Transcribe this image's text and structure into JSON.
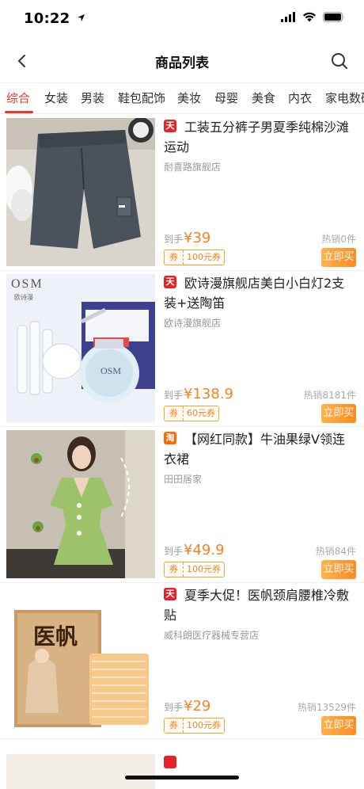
{
  "status_bar": {
    "time": "10:22",
    "location_icon": "location-arrow-icon",
    "signal_icon": "cellular-signal-icon",
    "wifi_icon": "wifi-icon",
    "battery_icon": "battery-icon"
  },
  "nav": {
    "title": "商品列表",
    "back_icon": "chevron-left-icon",
    "search_icon": "search-icon"
  },
  "categories": {
    "active_index": 0,
    "items": [
      "综合",
      "女装",
      "男装",
      "鞋包配饰",
      "美妆",
      "母婴",
      "美食",
      "内衣",
      "家电数码"
    ]
  },
  "products": [
    {
      "badge": "天",
      "platform": "tmall",
      "title": "工装五分裤子男夏季纯棉沙滩运动",
      "shop": "耐喜路旗舰店",
      "price_prefix": "到手",
      "price": "¥39",
      "sales": "热销0件",
      "coupon_tag": "券",
      "coupon_value": "100元券",
      "buy_label": "立即买"
    },
    {
      "badge": "天",
      "platform": "tmall",
      "title": "欧诗漫旗舰店美白小白灯2支装+送陶笛",
      "shop": "欧诗漫旗舰店",
      "price_prefix": "到手",
      "price": "¥138.9",
      "sales": "热销8181件",
      "coupon_tag": "券",
      "coupon_value": "60元券",
      "buy_label": "立即买",
      "image_text": {
        "brand": "OSM",
        "brand_cn": "欧诗漫"
      }
    },
    {
      "badge": "淘",
      "platform": "taobao",
      "title": "【网红同款】牛油果绿V领连衣裙",
      "shop": "田田居家",
      "price_prefix": "到手",
      "price": "¥49.9",
      "sales": "热销84件",
      "coupon_tag": "券",
      "coupon_value": "100元券",
      "buy_label": "立即买"
    },
    {
      "badge": "天",
      "platform": "tmall",
      "title": "夏季大促！医帆颈肩腰椎冷敷贴",
      "shop": "威科朗医疗器械专营店",
      "price_prefix": "到手",
      "price": "¥29",
      "sales": "热销13529件",
      "coupon_tag": "券",
      "coupon_value": "100元券",
      "buy_label": "立即买",
      "image_text": {
        "brand": "医帆"
      }
    }
  ],
  "colors": {
    "accent": "#e8382b",
    "price": "#f5821f",
    "tmall": "#e5242a",
    "taobao": "#ff6a00"
  }
}
